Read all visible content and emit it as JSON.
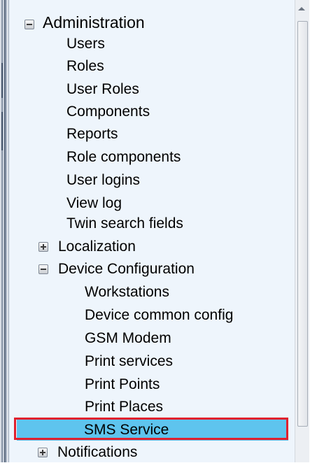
{
  "tree": {
    "root": {
      "label": "Administration",
      "state": "expanded"
    },
    "admin_items": [
      "Users",
      "Roles",
      "User Roles",
      "Components",
      "Reports",
      "Role components",
      "User logins",
      "View log",
      "Twin search fields"
    ],
    "localization": {
      "label": "Localization",
      "state": "collapsed"
    },
    "device_configuration": {
      "label": "Device Configuration",
      "state": "expanded",
      "items": [
        "Workstations",
        "Device common config",
        "GSM Modem",
        "Print services",
        "Print Points",
        "Print Places",
        "SMS Service"
      ],
      "selected": "SMS Service"
    },
    "notifications": {
      "label": "Notifications",
      "state": "collapsed"
    }
  },
  "colors": {
    "selection": "#5ec4ee",
    "highlight_border": "#e0212e",
    "panel_background": "#eef5fc"
  }
}
